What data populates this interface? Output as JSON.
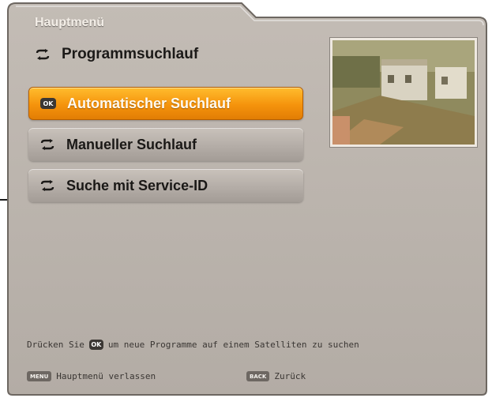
{
  "window": {
    "title": "Hauptmenü"
  },
  "section": {
    "title": "Programmsuchlauf"
  },
  "menu": {
    "ok_label": "OK",
    "items": [
      {
        "label": "Automatischer Suchlauf",
        "selected": true
      },
      {
        "label": "Manueller Suchlauf",
        "selected": false
      },
      {
        "label": "Suche mit Service-ID",
        "selected": false
      }
    ]
  },
  "hint": {
    "prefix": "Drücken Sie",
    "key": "OK",
    "suffix": "um neue Programme auf einem Satelliten zu suchen"
  },
  "footer": {
    "menu_key": "MENU",
    "menu_label": "Hauptmenü verlassen",
    "back_key": "BACK",
    "back_label": "Zurück"
  },
  "colors": {
    "panel": "#b9b2ab",
    "selected_item": "#f5930c",
    "item": "#b4ada7",
    "text": "#1a1816"
  }
}
